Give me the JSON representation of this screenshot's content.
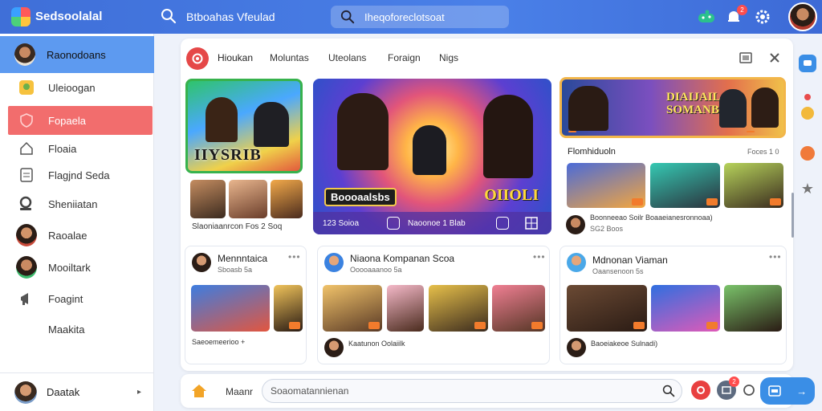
{
  "app": {
    "brand": "Sedsoolalal",
    "title": "Btboahas Vfeulad",
    "search_text": "Iheqoforeclotsoat"
  },
  "topbar": {
    "notification_count": "2"
  },
  "sidebar": {
    "items": [
      {
        "label": "Raonodoans"
      },
      {
        "label": "Uleioogan"
      },
      {
        "label": "Fopaela"
      },
      {
        "label": "Floaia"
      },
      {
        "label": "Flagjnd Seda"
      },
      {
        "label": "Sheniiatan"
      },
      {
        "label": "Raoalae"
      },
      {
        "label": "Mooiltark"
      },
      {
        "label": "Foagint"
      },
      {
        "label": "Maakita"
      }
    ],
    "footer_label": "Daatak"
  },
  "tabs": [
    "Hioukan",
    "Moluntas",
    "Uteolans",
    "Foraign",
    "Nigs"
  ],
  "feature1": {
    "banner": "IIYSRIB",
    "caption": "Slaoniaanrcon Fos 2 Soq"
  },
  "hero": {
    "title_left": "Boooaalsbs",
    "title_right": "OIIOLI",
    "stats": "123 Soioa",
    "bar_text": "Naoonoe 1 Blab"
  },
  "feature3": {
    "title": "DIAIJAIL SOMANBEN",
    "heading": "Flomhiduoln",
    "heading_meta": "Foces 1 0",
    "meta_line": "Boonneeao Soilr Boaaeianesronnoaa)",
    "meta_sub": "SG2 Boos"
  },
  "cards": [
    {
      "name": "Mennntaica",
      "sub": "Sboasb 5a",
      "footer": "Saeoemeerioo +"
    },
    {
      "name": "Niaona Kompanan Scoa",
      "sub": "Ooooaaanoo 5a",
      "footer": "Kaatunon Oolaiilk"
    },
    {
      "name": "Mdnonan Viaman",
      "sub": "Oaansenoon 5s",
      "footer": "Baoeiakeoe Sulnadi)"
    }
  ],
  "bottombar": {
    "label": "Maanr",
    "search_placeholder": "Soaomatannienan",
    "send_label": "→",
    "badge": "2"
  }
}
